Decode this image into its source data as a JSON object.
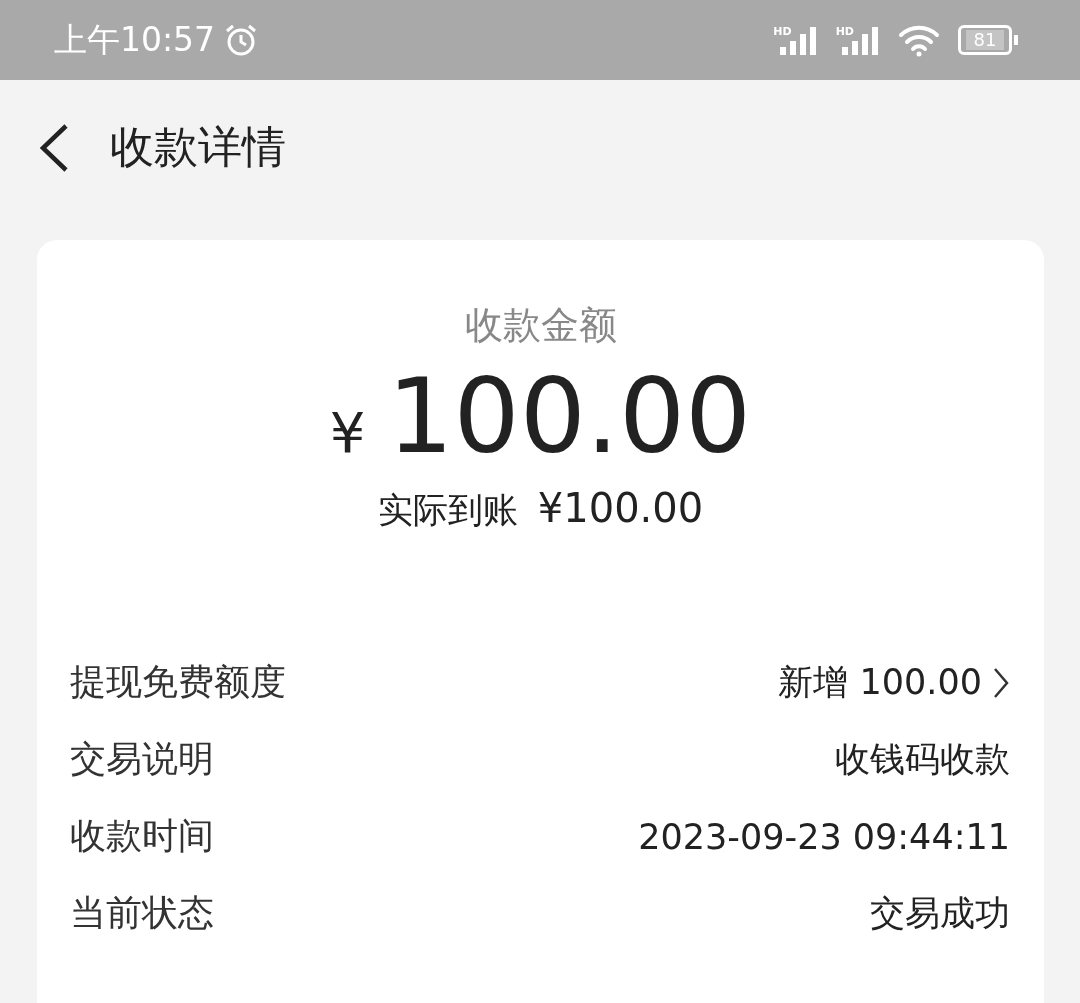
{
  "status_bar": {
    "time": "上午10:57",
    "signals": [
      {
        "label": "HD"
      },
      {
        "label": "HD"
      }
    ],
    "battery": "81"
  },
  "header": {
    "title": "收款详情"
  },
  "summary": {
    "label": "收款金额",
    "currency": "¥",
    "amount": "100.00",
    "received_label": "实际到账",
    "received_amount": "¥100.00"
  },
  "rows": [
    {
      "kind": "link",
      "label": "提现免费额度",
      "value": "新增 100.00"
    },
    {
      "kind": "plain",
      "label": "交易说明",
      "value": "收钱码收款"
    },
    {
      "kind": "plain",
      "label": "收款时间",
      "value": "2023-09-23 09:44:11"
    },
    {
      "kind": "plain",
      "label": "当前状态",
      "value": "交易成功"
    }
  ]
}
